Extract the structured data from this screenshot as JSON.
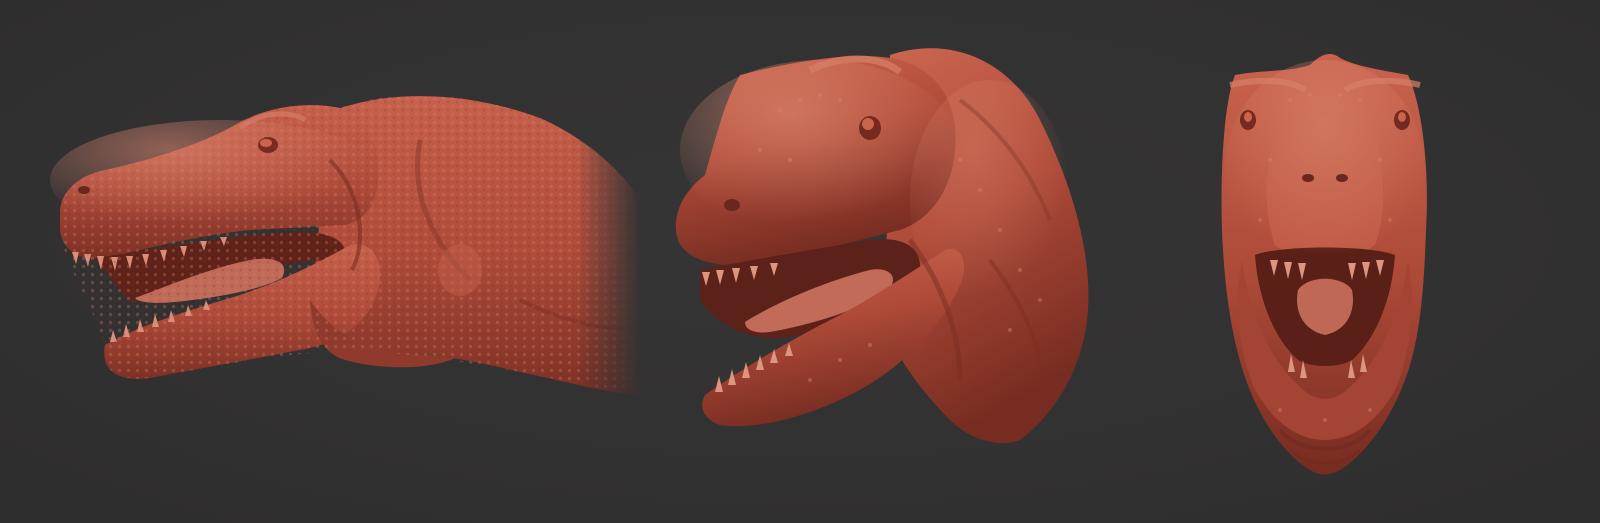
{
  "scene": {
    "background_color": "#333232",
    "clay_color": "#b4503f",
    "clay_highlight": "#d2735f",
    "clay_shadow": "#6e2a20",
    "views": [
      {
        "name": "side",
        "subject": "tyrannosaurus-head-sculpt"
      },
      {
        "name": "three-quarter",
        "subject": "tyrannosaurus-head-sculpt"
      },
      {
        "name": "front",
        "subject": "tyrannosaurus-head-sculpt"
      }
    ]
  }
}
